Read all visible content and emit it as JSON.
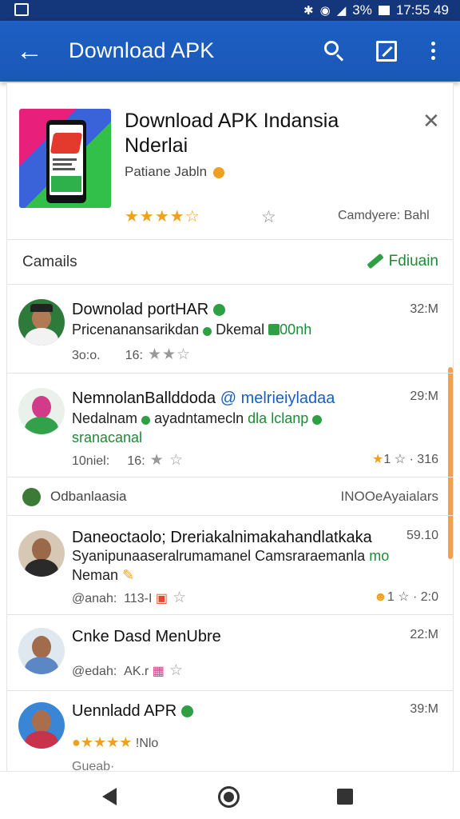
{
  "status_bar": {
    "battery": "3%",
    "time": "17:55 49"
  },
  "app_bar": {
    "title": "Download APK",
    "back_icon": "arrow-back-icon",
    "search_icon": "search-icon",
    "open_icon": "open-external-icon",
    "more_icon": "more-vert-icon"
  },
  "app_card": {
    "title": "Download APK Indansia Nderlai",
    "developer": "Patiane Jabln",
    "rating_stars": "★★★★☆",
    "fav_star": "☆",
    "category": "Camdyere: Bahl",
    "close_label": "✕"
  },
  "section": {
    "title": "Camails",
    "action": "Fdiuain"
  },
  "rows": [
    {
      "name": "Downolad portHAR",
      "time": "32:M",
      "text1_a": "Pricenanansarikdan",
      "text1_b": "Dkemal",
      "text1_c": "00nh",
      "meta": "3o:o.",
      "meta2": "16:",
      "stars": "★★☆"
    },
    {
      "name": "NemnolanBallddoda",
      "name_extra": "@ melrieiyladaa",
      "time": "29:M",
      "text1_a": "Nedalnam",
      "text1_b": "ayadntamecln",
      "text1_c": "dla lclanp",
      "text2": "sranacanal",
      "meta": "10niel:",
      "meta2": "16:",
      "stars": "★ ☆",
      "meta_right": "1 ☆ · 316"
    }
  ],
  "group": {
    "title": "Odbanlaasia",
    "right": "INOOeAyaialars"
  },
  "rows2": [
    {
      "name": "Daneoctaolo; Dreriakalnimakahandlatkaka",
      "time": "59.10",
      "text1": "Syanipunaaseralrumamanel Camsraraemanla",
      "text1_green": "mo",
      "text2": "Neman",
      "meta": "@anah:",
      "meta2": "113-I",
      "meta_right": "1 ☆ · 2:0"
    },
    {
      "name": "Cnke Dasd MenUbre",
      "time": "22:M",
      "meta": "@edah:",
      "meta2": "AK.r"
    },
    {
      "name": "Uennladd APR",
      "time": "39:M",
      "meta_stars": "★★★★",
      "meta2": "!Nlo",
      "partial": "Gueab·"
    }
  ],
  "nav": {
    "back_icon": "nav-back-icon",
    "home_icon": "nav-home-icon",
    "recent_icon": "nav-recent-icon"
  }
}
